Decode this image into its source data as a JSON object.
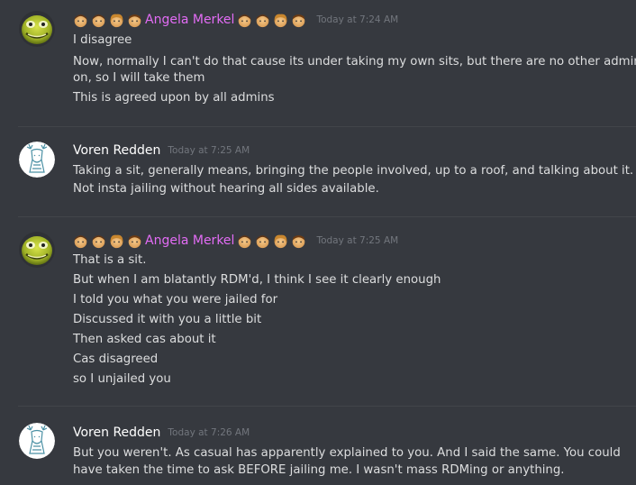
{
  "colors": {
    "background": "#36393f",
    "text": "#dcddde",
    "timestamp": "#72767d",
    "angela_name": "#e36cf5",
    "voren_name": "#ffffff"
  },
  "messages": [
    {
      "author": "Angela Merkel",
      "timestamp": "Today at 7:24 AM",
      "avatar_icon": "frog-face-icon",
      "lines": [
        "I disagree",
        "Now, normally I can't do that cause its under taking my own sits, but there are no other admins",
        "on, so I will take them",
        "This is agreed upon by all admins"
      ]
    },
    {
      "author": "Voren Redden",
      "timestamp": "Today at 7:25 AM",
      "avatar_icon": "deer-sketch-icon",
      "lines": [
        "Taking a sit, generally means, bringing the people involved, up to a roof, and talking about it.",
        "Not insta jailing without hearing all sides available."
      ]
    },
    {
      "author": "Angela Merkel",
      "timestamp": "Today at 7:25 AM",
      "avatar_icon": "frog-face-icon",
      "lines": [
        "That is a sit.",
        "But when I am blatantly RDM'd, I think I see it clearly enough",
        "I told you what you were jailed for",
        "Discussed it with you a little bit",
        "Then asked cas about it",
        "Cas disagreed",
        "so I unjailed you"
      ]
    },
    {
      "author": "Voren Redden",
      "timestamp": "Today at 7:26 AM",
      "avatar_icon": "deer-sketch-icon",
      "lines": [
        "But you weren't. As casual has apparently explained to you. And I said the same. You could",
        "have taken the time to ask BEFORE jailing me. I wasn't mass RDMing or anything."
      ]
    }
  ]
}
